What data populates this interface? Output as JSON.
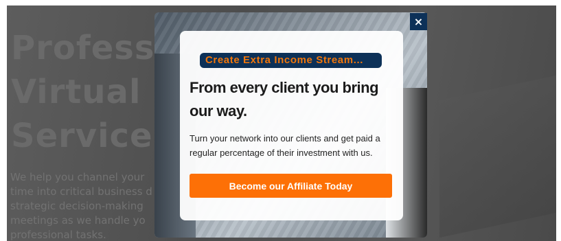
{
  "background_page": {
    "headline_lines": [
      "Professi",
      "Virtual S",
      "Services"
    ],
    "paragraph_lines": [
      "We help you channel your",
      "time into critical business d",
      "strategic decision-making",
      "meetings as we handle yo",
      "professional tasks."
    ]
  },
  "popup": {
    "close_label": "×",
    "tagline": "Create Extra Income Stream...",
    "title": "From every client you bring our way.",
    "body": "Turn your network into our clients and get paid a regular percentage of their investment with us.",
    "cta_label": "Become our Affiliate Today"
  },
  "colors": {
    "badge_bg": "#0d3158",
    "badge_text": "#f0760b",
    "cta_bg": "#fd7006",
    "close_bg": "#0d3158"
  },
  "icons": {
    "close": "close-icon"
  }
}
